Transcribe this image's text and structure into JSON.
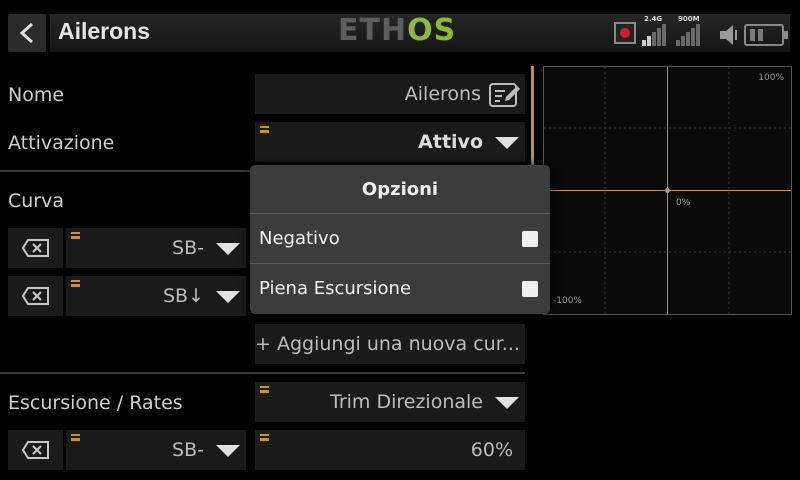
{
  "header": {
    "title": "Ailerons",
    "logo_eth": "ETH",
    "logo_os": "OS",
    "rf_label_1": "2.4G",
    "rf_label_2": "900M"
  },
  "form": {
    "name_label": "Nome",
    "name_value": "Ailerons",
    "activation_label": "Attivazione",
    "activation_value": "Attivo",
    "curve_label": "Curva",
    "curve_source_1": "SB-",
    "curve_source_2": "SB↓",
    "add_curve": "+ Aggiungi una nuova cur...",
    "rates_label": "Escursione / Rates",
    "rates_value": "Trim Direzionale",
    "rates_source": "SB-",
    "rates_percent": "60%"
  },
  "graph": {
    "top_label": "100%",
    "center_label": "0%",
    "bottom_label": "-100%"
  },
  "popup": {
    "title": "Opzioni",
    "options": [
      {
        "label": "Negativo",
        "checked": false
      },
      {
        "label": "Piena Escursione",
        "checked": false
      }
    ]
  },
  "colors": {
    "accent": "#c8922a",
    "logo_green": "#8eb83c",
    "record_red": "#d0202a"
  }
}
